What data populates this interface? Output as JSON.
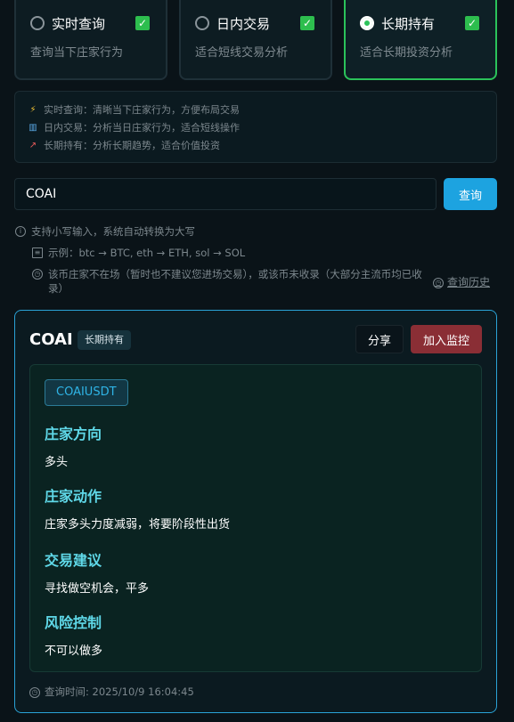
{
  "modes": [
    {
      "title": "实时查询",
      "desc": "查询当下庄家行为",
      "active": false
    },
    {
      "title": "日内交易",
      "desc": "适合短线交易分析",
      "active": false
    },
    {
      "title": "长期持有",
      "desc": "适合长期投资分析",
      "active": true
    }
  ],
  "info": {
    "line1": "实时查询：清晰当下庄家行为，方便布局交易",
    "line2": "日内交易：分析当日庄家行为，适合短线操作",
    "line3": "长期持有：分析长期趋势，适合价值投资"
  },
  "search": {
    "value": "COAI",
    "button": "查询"
  },
  "hints": {
    "line1": "支持小写输入，系统自动转换为大写",
    "line2": "示例：btc → BTC, eth → ETH, sol → SOL",
    "line3": "该币庄家不在场（暂时也不建议您进场交易），或该币未收录（大部分主流币均已收录）",
    "history": "查询历史"
  },
  "result": {
    "title": "COAI",
    "badge": "长期持有",
    "share": "分享",
    "monitor": "加入监控",
    "symbol": "COAIUSDT",
    "direction_title": "庄家方向",
    "direction_value": "多头",
    "action_title": "庄家动作",
    "action_value": "庄家多头力度减弱，将要阶段性出货",
    "advice_title": "交易建议",
    "advice_value": "寻找做空机会，平多",
    "risk_title": "风险控制",
    "risk_value": "不可以做多",
    "time": "查询时间: 2025/10/9 16:04:45"
  },
  "colors": {
    "accent": "#1da3e0",
    "active_border": "#2bc25a",
    "monitor": "#8a2e35",
    "section_title": "#5fd8e8"
  }
}
